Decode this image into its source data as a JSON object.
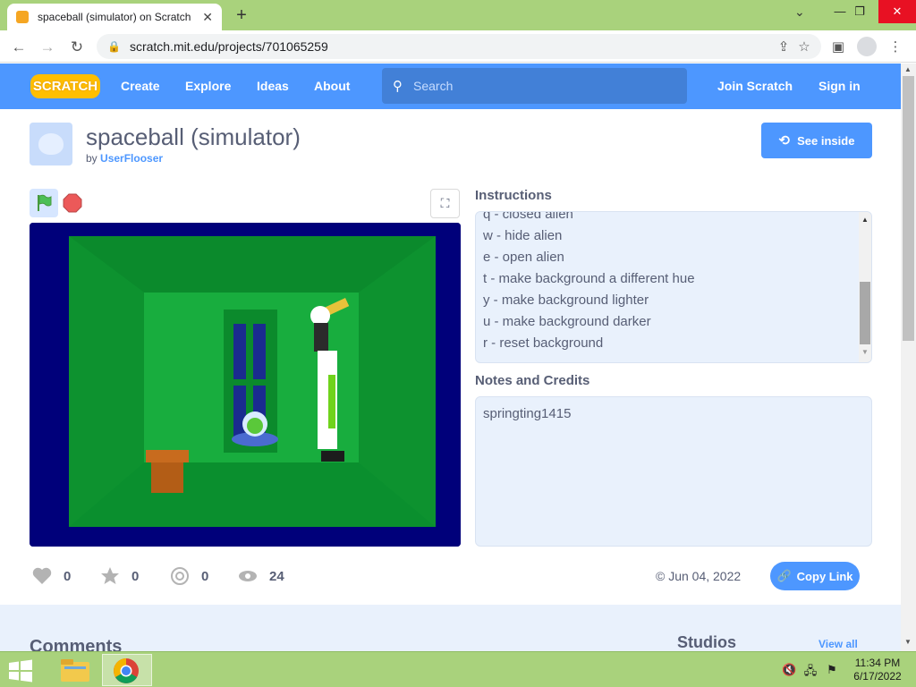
{
  "browser": {
    "tab_title": "spaceball (simulator) on Scratch",
    "url": "scratch.mit.edu/projects/701065259"
  },
  "scratch_nav": {
    "logo": "SCRATCH",
    "links": [
      "Create",
      "Explore",
      "Ideas",
      "About"
    ],
    "search_placeholder": "Search",
    "join": "Join Scratch",
    "signin": "Sign in",
    "colors": {
      "nav_blue": "#4d97ff",
      "logo_yellow": "#ffbf00"
    }
  },
  "project": {
    "title": "spaceball (simulator)",
    "by_prefix": "by",
    "author": "UserFlooser",
    "see_inside": "See inside",
    "instructions_label": "Instructions",
    "instructions": [
      "q - closed alien",
      "w - hide alien",
      "e - open alien",
      "t - make background a different hue",
      "y - make background lighter",
      "u - make background darker",
      "r - reset background"
    ],
    "notes_label": "Notes and Credits",
    "notes": "springting1415",
    "stats": {
      "loves": "0",
      "favorites": "0",
      "remixes": "0",
      "views": "24"
    },
    "date": "© Jun 04, 2022",
    "copy_link": "Copy Link"
  },
  "lower": {
    "comments": "Comments",
    "studios": "Studios",
    "view_all": "View all"
  },
  "taskbar": {
    "time": "11:34 PM",
    "date": "6/17/2022"
  }
}
